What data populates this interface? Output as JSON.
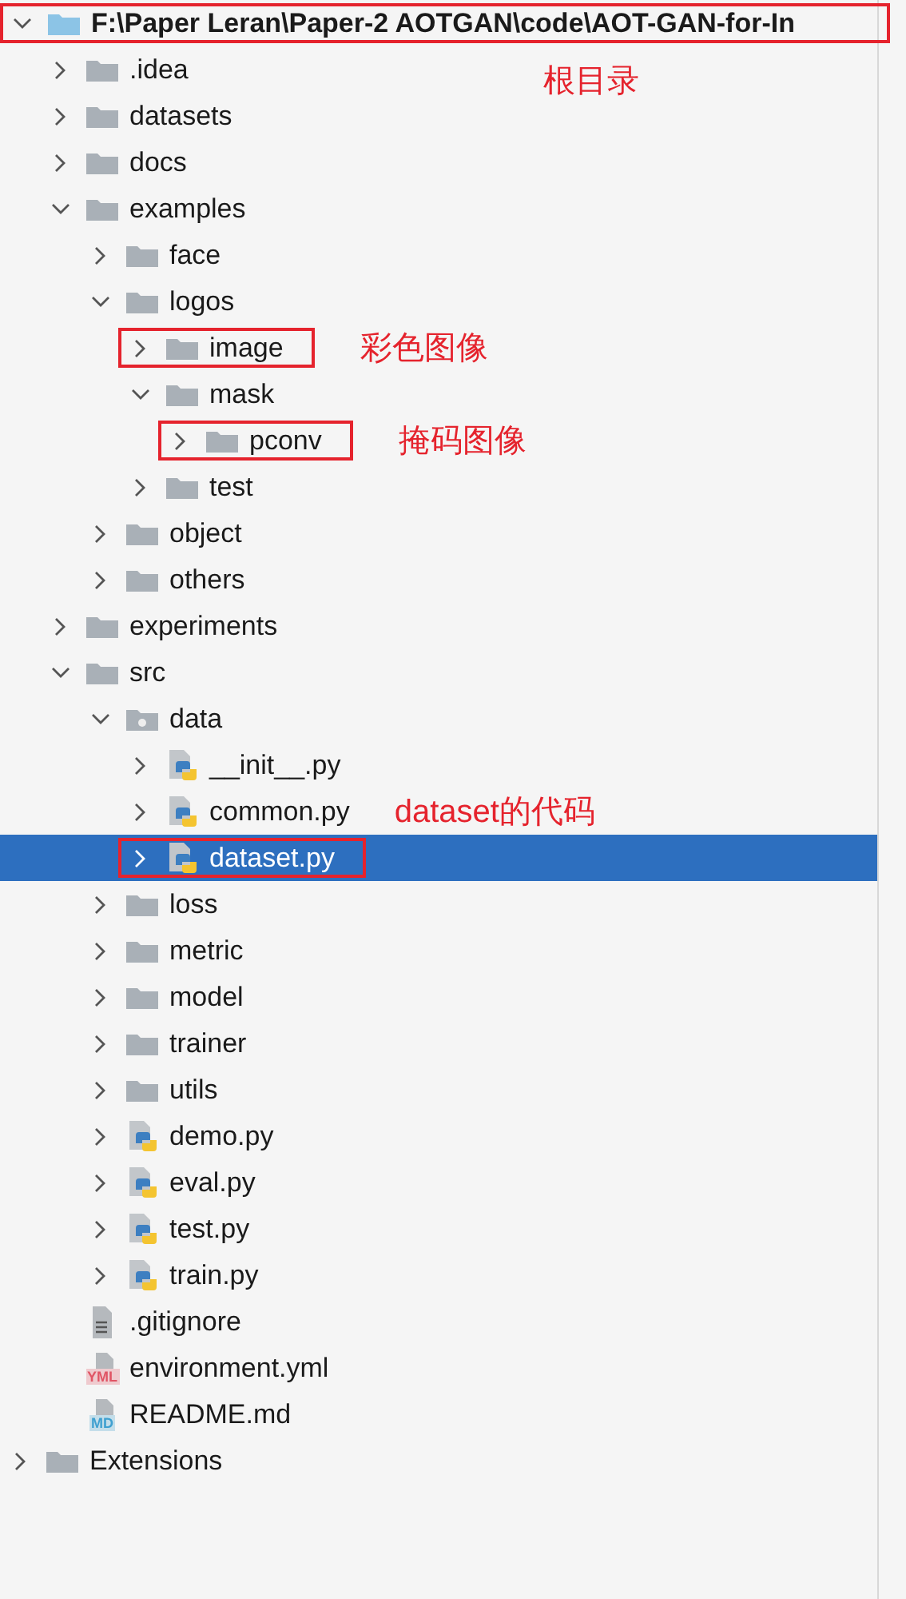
{
  "tree": [
    {
      "name": "F:\\Paper Leran\\Paper-2 AOTGAN\\code\\AOT-GAN-for-In",
      "kind": "module-folder",
      "expanded": true,
      "selected": false,
      "boxed": true,
      "note": "根目录",
      "children": [
        {
          "name": ".idea",
          "kind": "folder",
          "expanded": false,
          "selected": false
        },
        {
          "name": "datasets",
          "kind": "folder",
          "expanded": false,
          "selected": false
        },
        {
          "name": "docs",
          "kind": "folder",
          "expanded": false,
          "selected": false
        },
        {
          "name": "examples",
          "kind": "folder",
          "expanded": true,
          "selected": false,
          "children": [
            {
              "name": "face",
              "kind": "folder",
              "expanded": false,
              "selected": false
            },
            {
              "name": "logos",
              "kind": "folder",
              "expanded": true,
              "selected": false,
              "children": [
                {
                  "name": "image",
                  "kind": "folder",
                  "expanded": false,
                  "selected": false,
                  "boxed": true,
                  "note": "彩色图像"
                },
                {
                  "name": "mask",
                  "kind": "folder",
                  "expanded": true,
                  "selected": false,
                  "children": [
                    {
                      "name": "pconv",
                      "kind": "folder",
                      "expanded": false,
                      "selected": false,
                      "boxed": true,
                      "note": "掩码图像"
                    }
                  ]
                },
                {
                  "name": "test",
                  "kind": "folder",
                  "expanded": false,
                  "selected": false
                }
              ]
            },
            {
              "name": "object",
              "kind": "folder",
              "expanded": false,
              "selected": false
            },
            {
              "name": "others",
              "kind": "folder",
              "expanded": false,
              "selected": false
            }
          ]
        },
        {
          "name": "experiments",
          "kind": "folder",
          "expanded": false,
          "selected": false
        },
        {
          "name": "src",
          "kind": "folder",
          "expanded": true,
          "selected": false,
          "children": [
            {
              "name": "data",
              "kind": "package-folder",
              "expanded": true,
              "selected": false,
              "children": [
                {
                  "name": "__init__.py",
                  "kind": "python",
                  "expanded": false,
                  "selected": false
                },
                {
                  "name": "common.py",
                  "kind": "python",
                  "expanded": false,
                  "selected": false,
                  "note": "dataset的代码"
                },
                {
                  "name": "dataset.py",
                  "kind": "python",
                  "expanded": false,
                  "selected": true,
                  "boxed": true
                }
              ]
            },
            {
              "name": "loss",
              "kind": "folder",
              "expanded": false,
              "selected": false
            },
            {
              "name": "metric",
              "kind": "folder",
              "expanded": false,
              "selected": false
            },
            {
              "name": "model",
              "kind": "folder",
              "expanded": false,
              "selected": false
            },
            {
              "name": "trainer",
              "kind": "folder",
              "expanded": false,
              "selected": false
            },
            {
              "name": "utils",
              "kind": "folder",
              "expanded": false,
              "selected": false
            },
            {
              "name": "demo.py",
              "kind": "python",
              "expanded": false,
              "selected": false
            },
            {
              "name": "eval.py",
              "kind": "python",
              "expanded": false,
              "selected": false
            },
            {
              "name": "test.py",
              "kind": "python",
              "expanded": false,
              "selected": false
            },
            {
              "name": "train.py",
              "kind": "python",
              "expanded": false,
              "selected": false
            }
          ]
        },
        {
          "name": ".gitignore",
          "kind": "text",
          "selected": false
        },
        {
          "name": "environment.yml",
          "kind": "badge-file",
          "badge": "YML",
          "color": "#e05565",
          "selected": false
        },
        {
          "name": "README.md",
          "kind": "badge-file",
          "badge": "MD",
          "color": "#3fa0d0",
          "selected": false
        }
      ]
    },
    {
      "name": "Extensions",
      "kind": "folder",
      "expanded": false,
      "selected": false
    }
  ]
}
